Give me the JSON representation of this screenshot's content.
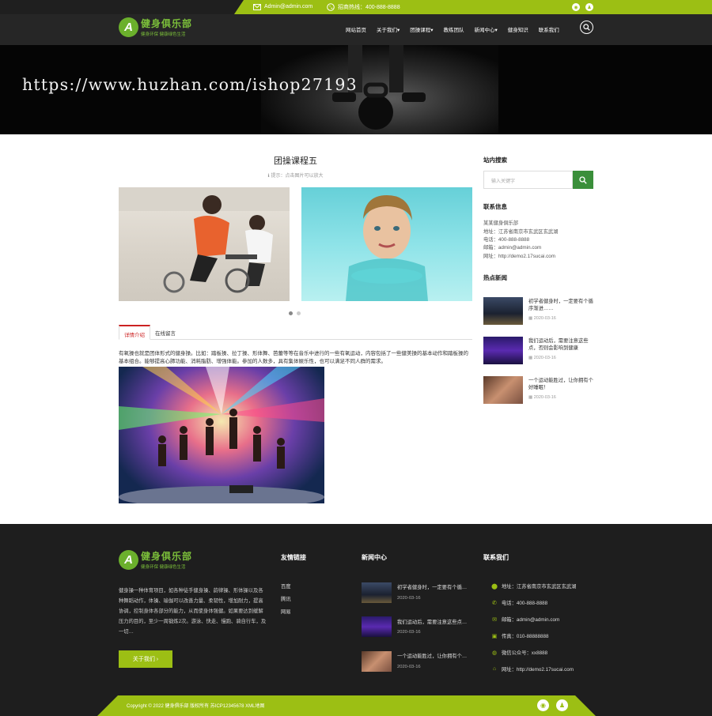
{
  "topbar": {
    "email": "Admin@admin.com",
    "hotline": "招商热线：400-888-8888",
    "icons": [
      "mail-icon",
      "phone-icon",
      "weibo-icon",
      "qq-icon"
    ]
  },
  "brand": {
    "name": "健身俱乐部",
    "tagline": "健身环保  健康绿色生活",
    "logo_letter": "A",
    "green": "#9cbf14",
    "logo_green": "#6bb02c"
  },
  "nav": {
    "items": [
      "网站首页",
      "关于我们▾",
      "团操课程▾",
      "教练团队",
      "新闻中心▾",
      "健身知识",
      "联系我们"
    ]
  },
  "banner": {
    "watermark": "https://www.huzhan.com/ishop27193"
  },
  "article": {
    "title": "团操课程五",
    "hint": "提示：点击图片可以放大",
    "carousel_dots": 2,
    "tabs": [
      "详情介绍",
      "在线留言"
    ],
    "description": "有氧操也就是团体形式的健身操。比如：踏板操、拉丁操、形体舞、芭蕾等等在音乐中进行的一些有氧运动，内容包括了一些健美操的基本动作和踏板操的基本组合。能够提高心肺功能、消耗脂肪、增强体能。参加的人数多，具有集体娱乐性，也可以满足不同人群的需求。"
  },
  "sidebar": {
    "search_heading": "站内搜索",
    "search_placeholder": "输入关键字",
    "contact_heading": "联系信息",
    "contact": [
      "某某健身俱乐部",
      "地址：江苏省南京市玄武区玄武湖",
      "电话：400-888-8888",
      "邮箱：admin@admin.com",
      "网址：http://demo2.17sucai.com"
    ],
    "hot_heading": "热点新闻",
    "hot_news": [
      {
        "title": "初学者健身时，一定要有个循序渐进……",
        "date": "2020-03-16"
      },
      {
        "title": "我们运动后，需要注意这些点，否则会影响到健康",
        "date": "2020-03-16"
      },
      {
        "title": "一个运动能胜过，让你拥有个好睡眠！",
        "date": "2020-03-16"
      }
    ]
  },
  "footer": {
    "about": "健身操一种体育项目，如各种徒手健身操、韵律操、形体操以及各种舞蹈动作，体操、瑜伽可以改善力量、柔韧性，增加耐力，提高协调，控制身体各部分的能力，从而使身体强健。如果要达到缓解压力的目的，至少一周锻炼2次。游泳、快走、慢跑、骑自行车，及一切…",
    "about_button": "关于我们",
    "links_heading": "友情链接",
    "links": [
      "百度",
      "腾讯",
      "网易"
    ],
    "news_heading": "新闻中心",
    "news": [
      {
        "title": "初学者健身时，一定要有个循…",
        "date": "2020-03-16"
      },
      {
        "title": "我们运动后，需要注意这些点…",
        "date": "2020-03-16"
      },
      {
        "title": "一个运动能胜过，让你拥有个…",
        "date": "2020-03-16"
      }
    ],
    "contact_heading": "联系我们",
    "contact": [
      {
        "icon": "location-icon",
        "text": "地址：江苏省南京市玄武区玄武湖"
      },
      {
        "icon": "phone-icon",
        "text": "电话：400-888-8888"
      },
      {
        "icon": "mail-icon",
        "text": "邮箱：admin@admin.com"
      },
      {
        "icon": "fax-icon",
        "text": "传真：010-88888888"
      },
      {
        "icon": "wechat-icon",
        "text": "微信公众号：xx8888"
      },
      {
        "icon": "home-icon",
        "text": "网址：http://demo2.17sucai.com"
      }
    ],
    "copyright": "Copyright © 2022 健身俱乐部 版权所有 苏ICP12345678 XML地图"
  }
}
